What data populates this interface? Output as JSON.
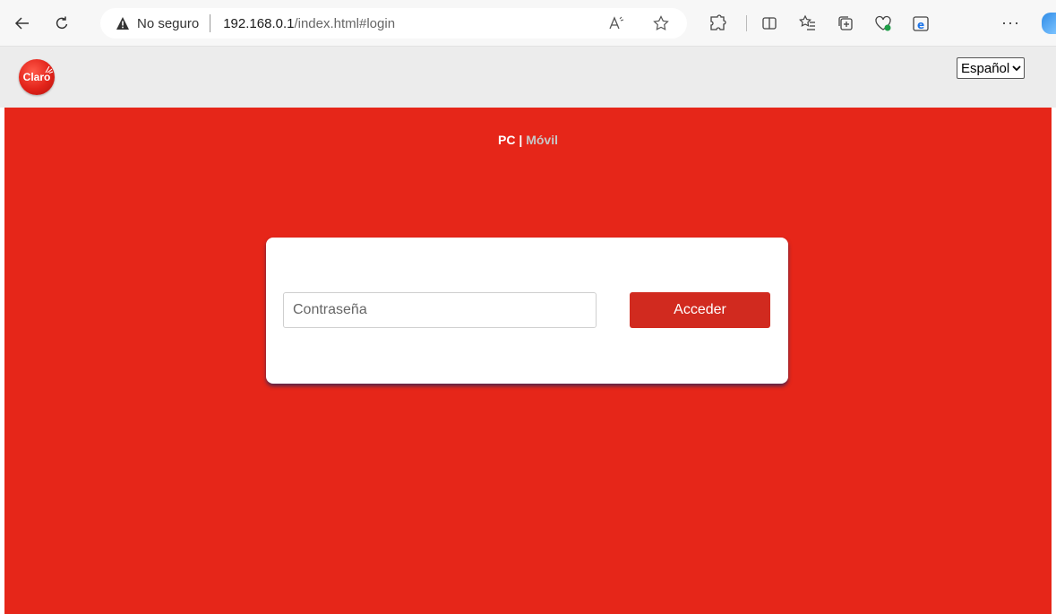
{
  "browser": {
    "not_secure_label": "No seguro",
    "url_host": "192.168.0.1",
    "url_path": "/index.html#login",
    "more_label": "···"
  },
  "header": {
    "logo_text": "Claro",
    "language_selected": "Español"
  },
  "mode_switch": {
    "pc_label": "PC",
    "separator": "|",
    "mobile_label": "Móvil"
  },
  "login": {
    "password_placeholder": "Contraseña",
    "submit_label": "Acceder"
  },
  "colors": {
    "brand_red": "#e62619",
    "button_red": "#d12a1f",
    "header_gray": "#ececec"
  }
}
